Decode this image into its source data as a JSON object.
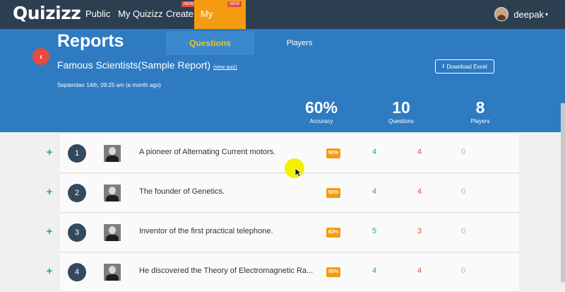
{
  "nav": {
    "logo": "Quizizz",
    "items": [
      {
        "label": "Public"
      },
      {
        "label": "My Quizizz"
      },
      {
        "label": "Create",
        "badge": "NEW"
      },
      {
        "label": "My Reports",
        "badge": "NEW"
      }
    ],
    "user": {
      "name": "deepak",
      "caret": "▾"
    }
  },
  "header": {
    "back_icon": "‹",
    "title": "Reports",
    "tabs": [
      {
        "label": "Questions"
      },
      {
        "label": "Players"
      }
    ],
    "quiz_name": "Famous Scientists(Sample Report)",
    "view_quiz": "(view quiz)",
    "date": "September 14th, 09:25 am (a month ago)",
    "download": {
      "icon": "⭳",
      "label": "Download Excel"
    },
    "stats": [
      {
        "value": "60%",
        "label": "Accuracy"
      },
      {
        "value": "10",
        "label": "Questions"
      },
      {
        "value": "8",
        "label": "Players"
      }
    ]
  },
  "questions": [
    {
      "plus": "+",
      "number": "1",
      "text": "A pioneer of Alternating Current motors.",
      "accuracy": "50%",
      "correct": "4",
      "incorrect": "4",
      "unattempted": "0"
    },
    {
      "plus": "+",
      "number": "2",
      "text": "The founder of Genetics.",
      "accuracy": "50%",
      "correct": "4",
      "incorrect": "4",
      "unattempted": "0"
    },
    {
      "plus": "+",
      "number": "3",
      "text": "Inventor of the first practical telephone.",
      "accuracy": "62%",
      "correct": "5",
      "incorrect": "3",
      "unattempted": "0"
    },
    {
      "plus": "+",
      "number": "4",
      "text": "He discovered the Theory of Electromagnetic Ra...",
      "accuracy": "50%",
      "correct": "4",
      "incorrect": "4",
      "unattempted": "0"
    }
  ],
  "colors": {
    "nav_bg": "#2c3e50",
    "header_bg": "#2e7bc2",
    "accent": "#f39c12",
    "correct": "#27ae60",
    "incorrect": "#e74c3c"
  }
}
